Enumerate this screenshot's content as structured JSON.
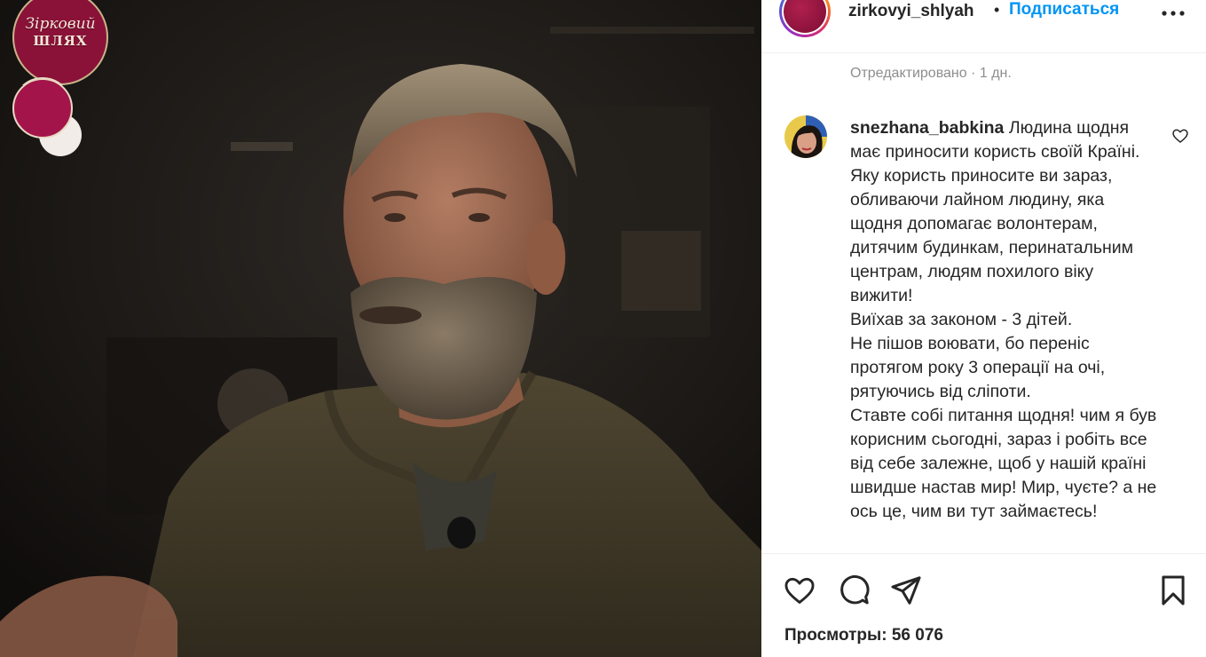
{
  "media": {
    "brand_line1": "Зірковий",
    "brand_line2": "ШЛЯХ"
  },
  "post": {
    "username": "zirkovyi_shlyah",
    "separator": "•",
    "follow_label": "Подписаться",
    "edited_label": "Отредактировано · 1 дн.",
    "views_label": "Просмотры: 56 076"
  },
  "comment": {
    "username": "snezhana_babkina",
    "text": " Людина щодня має приносити користь своїй Країні. Яку користь приносите ви зараз, обливаючи лайном людину, яка щодня допомагає волонтерам, дитячим будинкам, перинатальним центрам, людям похилого віку вижити!\nВиїхав за законом - 3 дітей.\nНе пішов воювати, бо переніс протягом року 3 операції на очі, рятуючись від сліпоти.\nСтавте собі питання щодня! чим я був корисним сьогодні, зараз і робіть все від себе залежне, щоб у нашій країні швидше настав мир! Мир, чуєте? а не ось це, чим ви тут займаєтесь!"
  },
  "icons": {
    "more": "more-horizontal-icon",
    "comment_like": "heart-outline-icon",
    "like": "heart-outline-icon",
    "comment": "comment-bubble-icon",
    "share": "paper-plane-icon",
    "save": "bookmark-icon"
  },
  "colors": {
    "link_blue": "#0095f6",
    "text": "#262626",
    "muted": "#8e8e8e",
    "brand_maroon": "#8a1238"
  }
}
